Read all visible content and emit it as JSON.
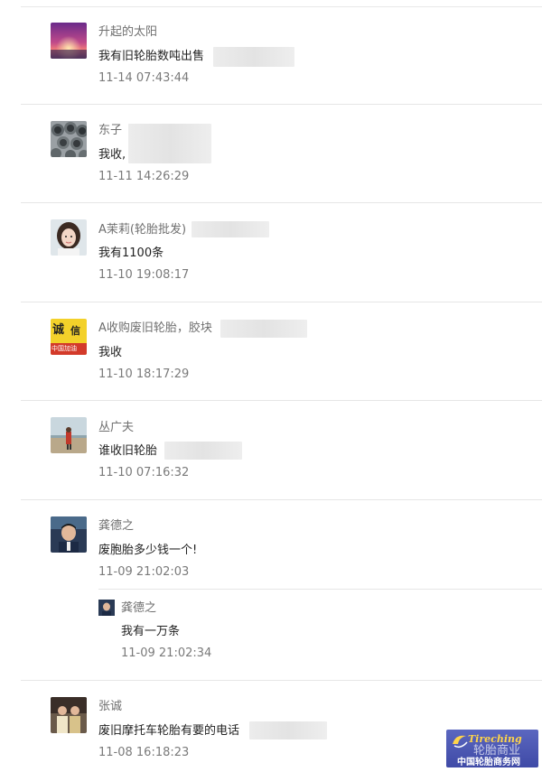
{
  "comments": [
    {
      "name": "升起的太阳",
      "text": "我有旧轮胎数吨出售",
      "time": "11-14 07:43:44"
    },
    {
      "name": "东子",
      "text": "我收,",
      "time": "11-11 14:26:29"
    },
    {
      "name": "A茉莉(轮胎批发)",
      "text": "我有1100条",
      "time": "11-10 19:08:17"
    },
    {
      "name": "A收购废旧轮胎，胶块",
      "avatar_text": {
        "line1": "诚",
        "line2": "信",
        "line3": "中国加油"
      },
      "text": "我收",
      "time": "11-10 18:17:29"
    },
    {
      "name": "丛广夫",
      "text": "谁收旧轮胎",
      "time": "11-10 07:16:32"
    },
    {
      "name": "龚德之",
      "text": "废胞胎多少钱一个!",
      "time": "11-09 21:02:03",
      "reply": {
        "name": "龚德之",
        "text": "我有一万条",
        "time": "11-09 21:02:34"
      }
    },
    {
      "name": "张诚",
      "text": "废旧摩托车轮胎有要的电话",
      "time": "11-08 16:18:23"
    }
  ],
  "watermark": {
    "brand": "Tireching",
    "cn_name": "轮胎商业",
    "site": "中国轮胎商务网",
    "colors": {
      "bg": "#4a55b0",
      "accent": "#ffd54a"
    }
  }
}
